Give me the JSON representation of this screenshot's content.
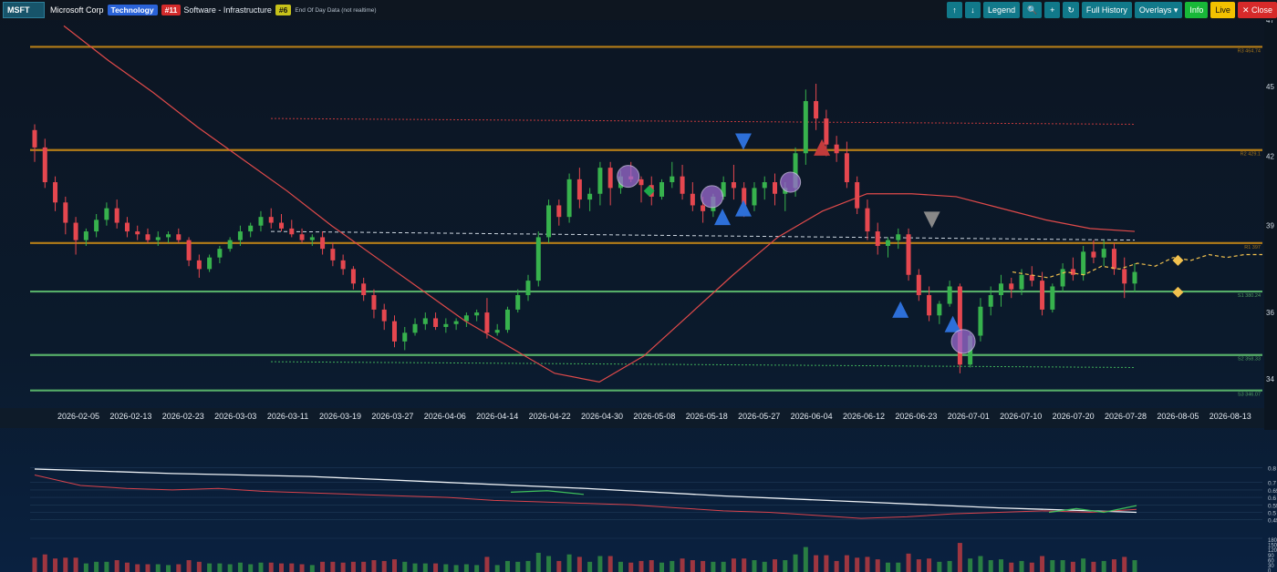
{
  "toolbar": {
    "ticker": "MSFT",
    "company": "Microsoft Corp",
    "sector": "Technology",
    "rank": "#11",
    "industry": "Software - Infrastructure",
    "industry_rank": "#6",
    "data_note": "End Of Day Data (not realtime)",
    "buttons": {
      "up": "↑",
      "down": "↓",
      "legend": "Legend",
      "zoom": "🔍",
      "add": "+",
      "refresh": "↻",
      "history": "Full History",
      "overlays": "Overlays ▾",
      "info": "Info",
      "live": "Live",
      "close": "✕ Close"
    }
  },
  "colors": {
    "up": "#37b24d",
    "down": "#e5474f",
    "resistance": "#c98a16",
    "support": "#5fbf6f",
    "ma": "#e04a4a",
    "marker_blue": "#2d6fd8",
    "marker_purple": "#9b6ad0"
  },
  "chart_data": {
    "type": "candlestick",
    "x_labels": [
      "2026-02-05",
      "2026-02-13",
      "2026-02-23",
      "2026-03-03",
      "2026-03-11",
      "2026-03-19",
      "2026-03-27",
      "2026-04-06",
      "2026-04-14",
      "2026-04-22",
      "2026-04-30",
      "2026-05-08",
      "2026-05-18",
      "2026-05-27",
      "2026-06-04",
      "2026-06-12",
      "2026-06-23",
      "2026-07-01",
      "2026-07-10",
      "2026-07-20",
      "2026-07-28",
      "2026-08-05",
      "2026-08-13"
    ],
    "y_ticks": [
      "47",
      "45",
      "42",
      "39",
      "36",
      "34"
    ],
    "levels": [
      {
        "name": "R3",
        "label": "R3 464.74",
        "value": 464.74,
        "kind": "resistance"
      },
      {
        "name": "R2",
        "label": "R2 429.1",
        "value": 429.1,
        "kind": "resistance"
      },
      {
        "name": "R1",
        "label": "R1 397",
        "value": 397,
        "kind": "resistance"
      },
      {
        "name": "S1",
        "label": "S1 380.24",
        "value": 380.24,
        "kind": "support"
      },
      {
        "name": "S2",
        "label": "S2 358.33",
        "value": 358.33,
        "kind": "support"
      },
      {
        "name": "S3",
        "label": "S3 346.07",
        "value": 346.07,
        "kind": "support"
      }
    ],
    "candles": [
      [
        436,
        438,
        425,
        430
      ],
      [
        430,
        433,
        416,
        418
      ],
      [
        418,
        420,
        408,
        411
      ],
      [
        411,
        413,
        400,
        404
      ],
      [
        404,
        406,
        393,
        398
      ],
      [
        398,
        402,
        396,
        401
      ],
      [
        401,
        407,
        399,
        405
      ],
      [
        405,
        411,
        403,
        409
      ],
      [
        409,
        412,
        402,
        404
      ],
      [
        404,
        406,
        399,
        401
      ],
      [
        401,
        403,
        398,
        400
      ],
      [
        400,
        402,
        397,
        398
      ],
      [
        398,
        401,
        396,
        399
      ],
      [
        399,
        401,
        397,
        400
      ],
      [
        400,
        402,
        397,
        398
      ],
      [
        398,
        399,
        389,
        391
      ],
      [
        391,
        393,
        385,
        388
      ],
      [
        388,
        393,
        387,
        392
      ],
      [
        392,
        396,
        390,
        395
      ],
      [
        395,
        399,
        394,
        398
      ],
      [
        398,
        403,
        396,
        401
      ],
      [
        401,
        404,
        399,
        403
      ],
      [
        403,
        408,
        401,
        406
      ],
      [
        406,
        409,
        402,
        404
      ],
      [
        404,
        407,
        401,
        402
      ],
      [
        402,
        405,
        399,
        400
      ],
      [
        400,
        402,
        397,
        398
      ],
      [
        398,
        400,
        396,
        399
      ],
      [
        399,
        401,
        393,
        395
      ],
      [
        395,
        397,
        389,
        391
      ],
      [
        391,
        393,
        386,
        388
      ],
      [
        388,
        389,
        381,
        383
      ],
      [
        383,
        385,
        377,
        379
      ],
      [
        379,
        381,
        371,
        374
      ],
      [
        374,
        376,
        367,
        370
      ],
      [
        370,
        372,
        361,
        363
      ],
      [
        363,
        368,
        360,
        366
      ],
      [
        366,
        371,
        365,
        369
      ],
      [
        369,
        373,
        367,
        371
      ],
      [
        371,
        373,
        367,
        368
      ],
      [
        368,
        371,
        366,
        369
      ],
      [
        369,
        371,
        367,
        370
      ],
      [
        370,
        373,
        368,
        372
      ],
      [
        372,
        374,
        370,
        373
      ],
      [
        373,
        378,
        364,
        366
      ],
      [
        366,
        369,
        365,
        367
      ],
      [
        367,
        375,
        366,
        374
      ],
      [
        374,
        381,
        373,
        379
      ],
      [
        379,
        386,
        377,
        384
      ],
      [
        384,
        401,
        382,
        399
      ],
      [
        399,
        412,
        397,
        410
      ],
      [
        410,
        412,
        403,
        406
      ],
      [
        406,
        421,
        404,
        419
      ],
      [
        419,
        423,
        409,
        412
      ],
      [
        412,
        416,
        408,
        414
      ],
      [
        414,
        425,
        410,
        423
      ],
      [
        423,
        425,
        410,
        416
      ],
      [
        416,
        422,
        414,
        420
      ],
      [
        420,
        425,
        418,
        419
      ],
      [
        419,
        420,
        411,
        417
      ],
      [
        417,
        420,
        410,
        413
      ],
      [
        413,
        419,
        412,
        418
      ],
      [
        418,
        425,
        416,
        420
      ],
      [
        420,
        424,
        412,
        414
      ],
      [
        414,
        418,
        408,
        410
      ],
      [
        410,
        413,
        404,
        408
      ],
      [
        408,
        414,
        406,
        413
      ],
      [
        413,
        420,
        412,
        418
      ],
      [
        418,
        424,
        412,
        416
      ],
      [
        416,
        418,
        406,
        410
      ],
      [
        410,
        418,
        408,
        416
      ],
      [
        416,
        420,
        412,
        418
      ],
      [
        418,
        421,
        410,
        414
      ],
      [
        414,
        418,
        408,
        416
      ],
      [
        416,
        430,
        413,
        428
      ],
      [
        428,
        450,
        424,
        446
      ],
      [
        446,
        452,
        436,
        440
      ],
      [
        440,
        443,
        427,
        431
      ],
      [
        431,
        434,
        425,
        428
      ],
      [
        428,
        432,
        416,
        418
      ],
      [
        418,
        420,
        407,
        409
      ],
      [
        409,
        412,
        398,
        401
      ],
      [
        401,
        404,
        393,
        396
      ],
      [
        396,
        399,
        392,
        398
      ],
      [
        398,
        402,
        395,
        400
      ],
      [
        400,
        402,
        384,
        386
      ],
      [
        386,
        388,
        377,
        379
      ],
      [
        379,
        382,
        370,
        372
      ],
      [
        372,
        377,
        369,
        376
      ],
      [
        376,
        384,
        375,
        382
      ],
      [
        382,
        383,
        352,
        355
      ],
      [
        355,
        366,
        354,
        365
      ],
      [
        365,
        378,
        363,
        375
      ],
      [
        375,
        382,
        372,
        379
      ],
      [
        379,
        386,
        375,
        383
      ],
      [
        383,
        385,
        378,
        381
      ],
      [
        381,
        388,
        379,
        386
      ],
      [
        386,
        389,
        382,
        384
      ],
      [
        384,
        387,
        372,
        374
      ],
      [
        374,
        383,
        373,
        382
      ],
      [
        382,
        390,
        380,
        388
      ],
      [
        388,
        392,
        384,
        386
      ],
      [
        386,
        396,
        384,
        394
      ],
      [
        394,
        398,
        390,
        392
      ],
      [
        392,
        398,
        389,
        395
      ],
      [
        395,
        397,
        386,
        388
      ],
      [
        388,
        392,
        378,
        383
      ],
      [
        383,
        390,
        380,
        387
      ]
    ],
    "ma_line": [
      472,
      460,
      449,
      437,
      426,
      415,
      403,
      392,
      381,
      370,
      361,
      352,
      349,
      358,
      372,
      386,
      399,
      408,
      414,
      414,
      413,
      409,
      405,
      402,
      401
    ],
    "forecast": [
      387,
      386,
      385,
      387,
      386,
      389,
      388,
      390,
      389,
      392,
      391,
      393,
      392,
      393,
      393
    ],
    "markers": [
      {
        "type": "triangle-down",
        "color": "#2d6fd8",
        "at": 12.7,
        "value": 432
      },
      {
        "type": "triangle-up",
        "color": "#2d6fd8",
        "at": 12.3,
        "value": 406
      },
      {
        "type": "triangle-up",
        "color": "#2d6fd8",
        "at": 12.7,
        "value": 409
      },
      {
        "type": "triangle-up",
        "color": "#c23b3b",
        "at": 14.2,
        "value": 430
      },
      {
        "type": "triangle-down",
        "color": "#888",
        "at": 16.3,
        "value": 405
      },
      {
        "type": "triangle-up",
        "color": "#2d6fd8",
        "at": 15.7,
        "value": 374
      },
      {
        "type": "triangle-up",
        "color": "#2d6fd8",
        "at": 16.7,
        "value": 369
      },
      {
        "type": "circle",
        "color": "#9b6ad0",
        "at": 10.5,
        "value": 420,
        "r": 12
      },
      {
        "type": "circle",
        "color": "#9b6ad0",
        "at": 12.1,
        "value": 413,
        "r": 12
      },
      {
        "type": "circle",
        "color": "#9b6ad0",
        "at": 13.6,
        "value": 418,
        "r": 11
      },
      {
        "type": "circle",
        "color": "#9b6ad0",
        "at": 16.9,
        "value": 363,
        "r": 13
      },
      {
        "type": "diamond",
        "color": "#1ea84a",
        "at": 10.9,
        "value": 415
      },
      {
        "type": "diamond",
        "color": "#f2c14e",
        "at": 21.0,
        "value": 380
      },
      {
        "type": "diamond",
        "color": "#f2c14e",
        "at": 21.0,
        "value": 391
      }
    ],
    "indicator": {
      "y_ticks": [
        "0.8",
        "0.7",
        "0.65",
        "0.6",
        "0.55",
        "0.5",
        "0.45"
      ],
      "white_line": [
        0.79,
        0.76,
        0.74,
        0.7,
        0.66,
        0.61,
        0.57,
        0.53,
        0.5
      ],
      "red_line": [
        0.75,
        0.68,
        0.66,
        0.65,
        0.66,
        0.64,
        0.63,
        0.62,
        0.61,
        0.6,
        0.58,
        0.57,
        0.56,
        0.55,
        0.53,
        0.51,
        0.5,
        0.48,
        0.46,
        0.47,
        0.49,
        0.5,
        0.51,
        0.5,
        0.52
      ]
    },
    "volume": {
      "y_ticks": [
        "180",
        "150",
        "120",
        "90",
        "60",
        "30",
        "0"
      ]
    }
  }
}
